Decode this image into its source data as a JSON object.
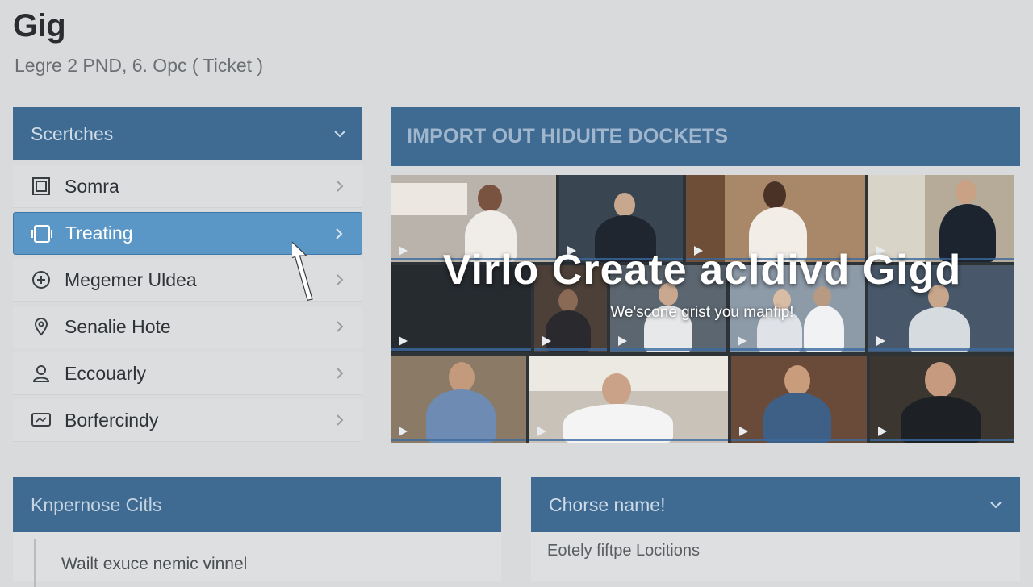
{
  "app": {
    "title": "Gig",
    "subtitle": "Legre 2 PND, 6. Opc ( Ticket )"
  },
  "nav": {
    "header_label": "Scertches",
    "items": [
      {
        "label": "Somra",
        "icon": "square-frame-icon",
        "active": false
      },
      {
        "label": "Treating",
        "icon": "tablet-icon",
        "active": true
      },
      {
        "label": "Megemer Uldea",
        "icon": "plus-circle-icon",
        "active": false
      },
      {
        "label": "Senalie Hote",
        "icon": "location-pin-icon",
        "active": false
      },
      {
        "label": "Eccouarly",
        "icon": "user-icon",
        "active": false
      },
      {
        "label": "Borfercindy",
        "icon": "screen-icon",
        "active": false
      }
    ]
  },
  "import": {
    "header_label": "IMPORT OUT HIDUITE DOCKETS",
    "overlay_title": "Virlo Create acldivd Gigd",
    "overlay_subtitle": "We'scone grist you manfip!"
  },
  "bottom_left": {
    "header_label": "Knpernose Citls",
    "body_text": "Wailt exuce nemic vinnel"
  },
  "bottom_right": {
    "header_label": "Chorse name!",
    "body_text": "Eotely fiftpe Locitions"
  },
  "colors": {
    "panel_header": "#3f6b93",
    "active_item": "#5a97c6",
    "background": "#d9dadb"
  }
}
